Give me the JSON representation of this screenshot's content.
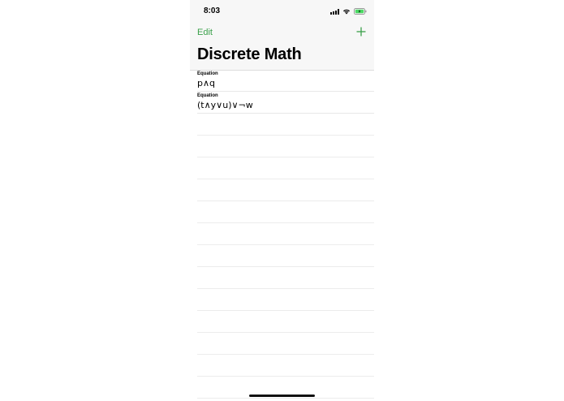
{
  "status_bar": {
    "time": "8:03",
    "icons": [
      "cellular-signal-icon",
      "wifi-icon",
      "battery-charging-icon"
    ]
  },
  "nav": {
    "edit_label": "Edit",
    "add_icon": "plus-icon",
    "title": "Discrete Math"
  },
  "colors": {
    "accent": "#3aa04a",
    "battery": "#4cd964"
  },
  "equations": [
    {
      "label": "Equation",
      "value": "p∧q"
    },
    {
      "label": "Equation",
      "value": "(t∧y∨u)∨¬w"
    }
  ]
}
